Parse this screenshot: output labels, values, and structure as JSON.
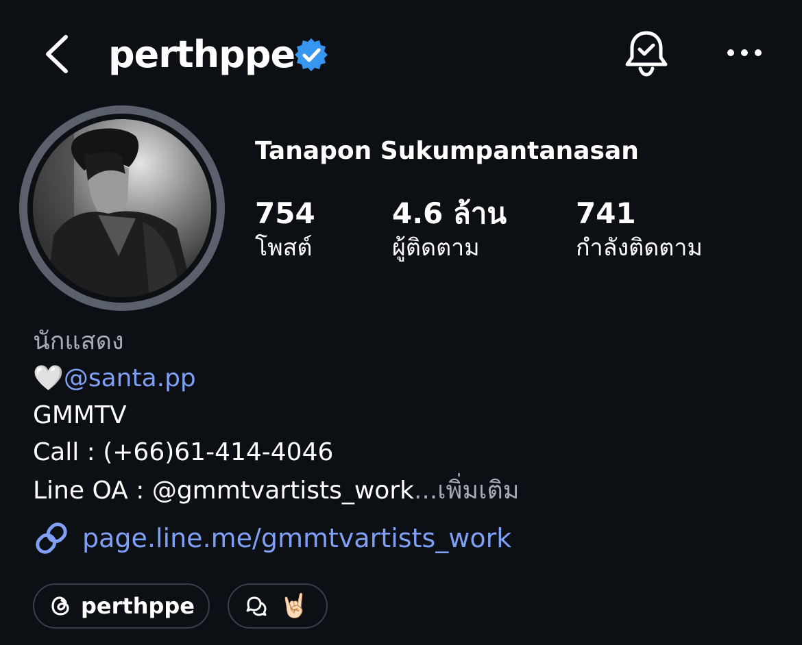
{
  "header": {
    "handle": "perthppe"
  },
  "profile": {
    "full_name": "Tanapon Sukumpantanasan",
    "stats": [
      {
        "value": "754",
        "label": "โพสต์"
      },
      {
        "value": "4.6 ล้าน",
        "label": "ผู้ติดตาม"
      },
      {
        "value": "741",
        "label": "กำลังติดตาม"
      }
    ]
  },
  "bio": {
    "category": "นักแสดง",
    "heart": "🤍",
    "mention": "@santa.pp",
    "line2": "GMMTV",
    "line3": "Call : (+66)61-414-4046",
    "line4": "Line OA : @gmmtvartists_work",
    "ellipsis": "...",
    "more_label": "เพิ่มเติม",
    "link": "page.line.me/gmmtvartists_work"
  },
  "chips": {
    "threads_label": "perthppe",
    "emoji": "🤘🏻"
  },
  "colors": {
    "background": "#0c0f14",
    "verified": "#3797f0",
    "link": "#7fa0f5",
    "muted": "#a8abb2"
  }
}
